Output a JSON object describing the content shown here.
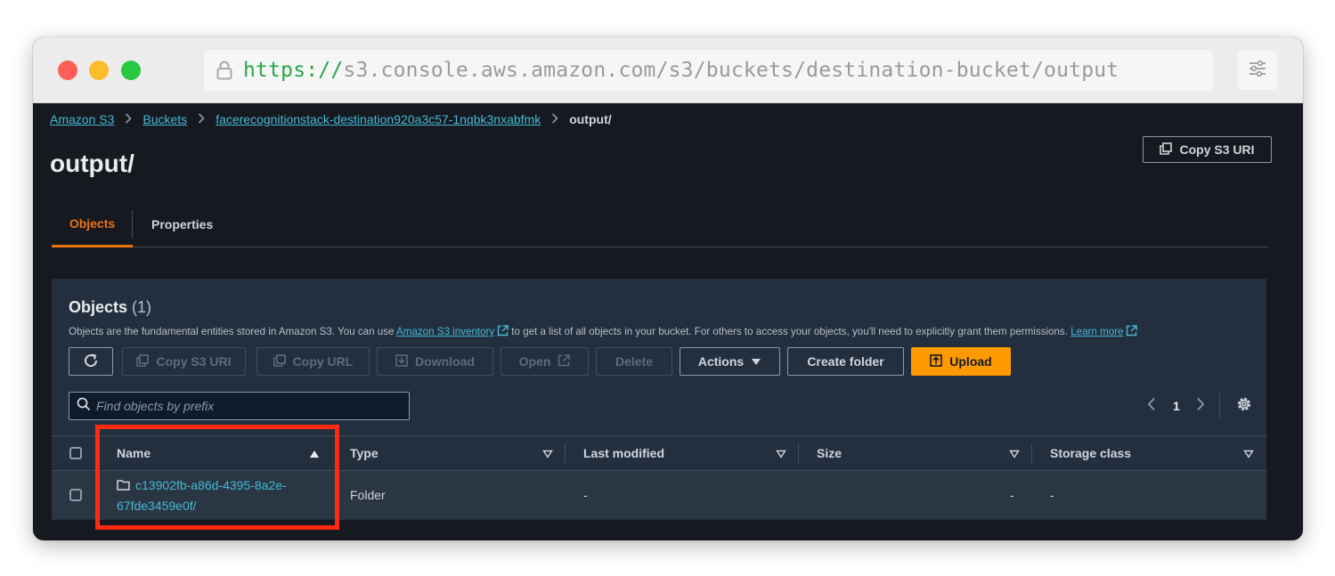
{
  "browser": {
    "url_protocol": "https",
    "url_separator": "://",
    "url_rest": "s3.console.aws.amazon.com/s3/buckets/destination-bucket/output"
  },
  "breadcrumb": {
    "items": [
      "Amazon S3",
      "Buckets",
      "facerecognitionstack-destination920a3c57-1nqbk3nxabfmk"
    ],
    "current": "output/"
  },
  "page": {
    "title": "output/",
    "copy_s3_uri": "Copy S3 URI"
  },
  "tabs": [
    {
      "label": "Objects",
      "active": true
    },
    {
      "label": "Properties",
      "active": false
    }
  ],
  "objects_panel": {
    "title": "Objects",
    "count": "(1)",
    "desc_part1": "Objects are the fundamental entities stored in Amazon S3. You can use",
    "inventory_link": "Amazon S3 inventory",
    "desc_part2": "to get a list of all objects in your bucket. For others to access your objects, you'll need to explicitly grant them permissions.",
    "learn_more": "Learn more"
  },
  "toolbar": {
    "copy_s3_uri": "Copy S3 URI",
    "copy_url": "Copy URL",
    "download": "Download",
    "open": "Open",
    "delete": "Delete",
    "actions": "Actions",
    "create_folder": "Create folder",
    "upload": "Upload"
  },
  "search": {
    "placeholder": "Find objects by prefix"
  },
  "pagination": {
    "current_page": "1"
  },
  "table": {
    "headers": [
      "Name",
      "Type",
      "Last modified",
      "Size",
      "Storage class"
    ],
    "rows": [
      {
        "name_line1": "c13902fb-a86d-4395-8a2e-",
        "name_line2": "67fde3459e0f/",
        "type": "Folder",
        "last_modified": "-",
        "size": "-",
        "storage_class": "-"
      }
    ]
  },
  "colors": {
    "accent": "#ec7211",
    "link": "#44b9d6",
    "primary_button": "#ff9900",
    "highlight_box": "#ff2a12"
  }
}
